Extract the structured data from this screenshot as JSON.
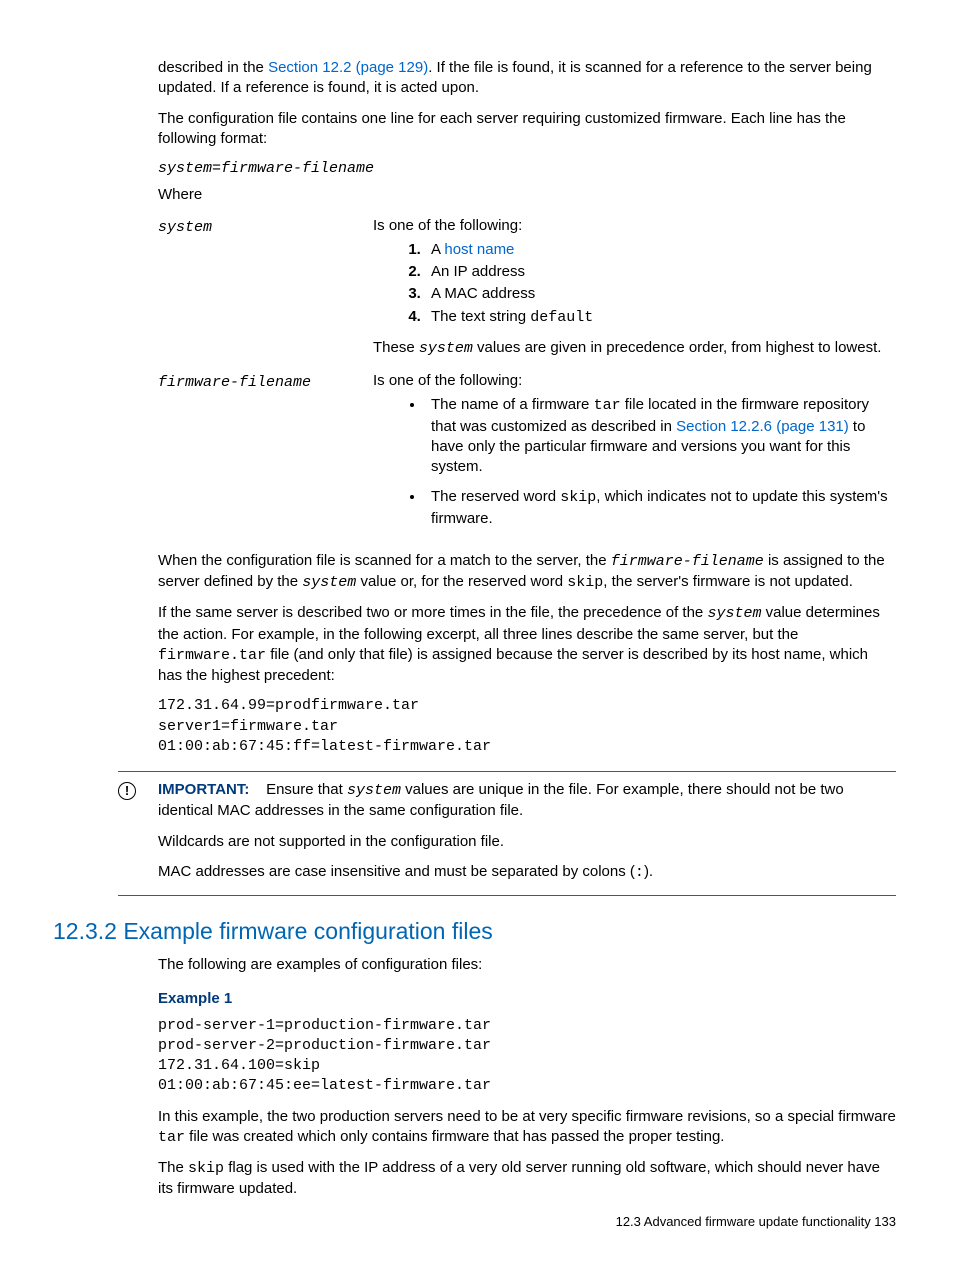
{
  "para1_a": "described in the ",
  "para1_link": "Section 12.2 (page 129)",
  "para1_b": ". If the file is found, it is scanned for a reference to the server being updated. If a reference is found, it is acted upon.",
  "para2": "The configuration file contains one line for each server requiring customized firmware. Each line has the following format:",
  "format_code_a": "system",
  "format_code_eq": "=",
  "format_code_b": "firmware-filename",
  "where_label": "Where",
  "def": {
    "system": {
      "term": "system",
      "intro": "Is one of the following:",
      "items": {
        "n1_a": "A ",
        "n1_link": "host name",
        "n2": "An IP address",
        "n3": "A MAC address",
        "n4_a": "The text string ",
        "n4_code": "default"
      },
      "after_a": "These ",
      "after_code": "system",
      "after_b": " values are given in precedence order, from highest to lowest."
    },
    "firmware": {
      "term": "firmware-filename",
      "intro": "Is one of the following:",
      "b1_a": "The name of a firmware ",
      "b1_code": "tar",
      "b1_b": " file located in the firmware repository that was customized as described in ",
      "b1_link": "Section 12.2.6 (page 131)",
      "b1_c": " to have only the particular firmware and versions you want for this system.",
      "b2_a": "The reserved word ",
      "b2_code": "skip",
      "b2_b": ", which indicates not to update this system's firmware."
    }
  },
  "para3_a": "When the configuration file is scanned for a match to the server, the ",
  "para3_code1": "firmware-filename",
  "para3_b": " is assigned to the server defined by the ",
  "para3_code2": "system",
  "para3_c": " value or, for the reserved word ",
  "para3_code3": "skip",
  "para3_d": ", the server's firmware is not updated.",
  "para4_a": "If the same server is described two or more times in the file, the precedence of the ",
  "para4_code1": "system",
  "para4_b": " value determines the action. For example, in the following excerpt, all three lines describe the same server, but the ",
  "para4_code2": "firmware.tar",
  "para4_c": " file (and only that file) is assigned because the server is described by its host name, which has the highest precedent:",
  "codeblock1": "172.31.64.99=prodfirmware.tar\nserver1=firmware.tar\n01:00:ab:67:45:ff=latest-firmware.tar",
  "callout": {
    "label": "IMPORTANT:",
    "p1_a": "Ensure that ",
    "p1_code": "system",
    "p1_b": " values are unique in the file. For example, there should not be two identical MAC addresses in the same configuration file.",
    "p2": "Wildcards are not supported in the configuration file.",
    "p3_a": "MAC addresses are case insensitive and must be separated by colons (",
    "p3_code": ":",
    "p3_b": ")."
  },
  "section_heading": "12.3.2 Example firmware configuration files",
  "para5": "The following are examples of configuration files:",
  "example1_label": "Example 1",
  "codeblock2": "prod-server-1=production-firmware.tar\nprod-server-2=production-firmware.tar\n172.31.64.100=skip\n01:00:ab:67:45:ee=latest-firmware.tar",
  "para6_a": "In this example, the two production servers need to be at very specific firmware revisions, so a special firmware ",
  "para6_code": "tar",
  "para6_b": " file was created which only contains firmware that has passed the proper testing.",
  "para7_a": "The ",
  "para7_code": "skip",
  "para7_b": " flag is used with the IP address of a very old server running old software, which should never have its firmware updated.",
  "footer": "12.3 Advanced firmware update functionality    133"
}
